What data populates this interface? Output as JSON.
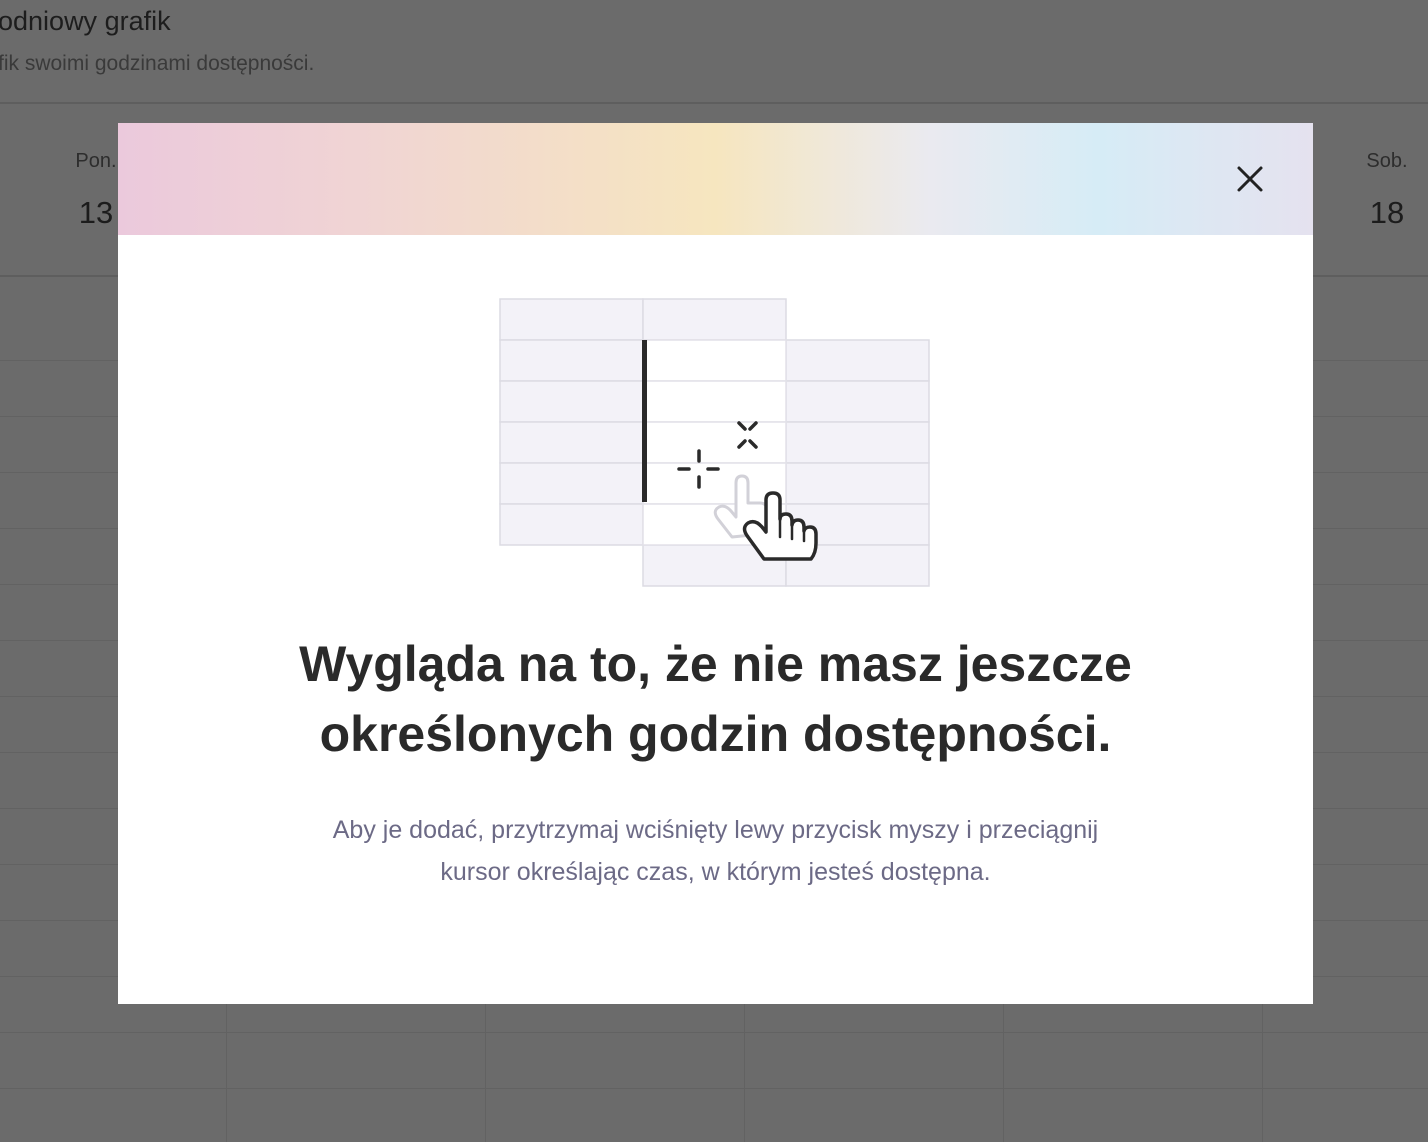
{
  "background": {
    "title": "odniowy grafik",
    "subtitle": "fik swoimi godzinami dostępności.",
    "days": [
      {
        "name": "Pon.",
        "number": "13"
      },
      {
        "name": "Sob.",
        "number": "18"
      }
    ]
  },
  "modal": {
    "close_icon": "close-icon",
    "illustration_icon": "drag-select-hand-icon",
    "heading_line1": "Wygląda na to, że nie masz jeszcze",
    "heading_line2": "określonych godzin dostępności.",
    "text_line1": "Aby je dodać, przytrzymaj wciśnięty lewy przycisk myszy i przeciągnij",
    "text_line2": "kursor określając czas, w którym jesteś dostępna.",
    "colors": {
      "heading": "#2a2a2a",
      "text": "#6c6a86",
      "overlay": "#6b6b6b"
    }
  }
}
